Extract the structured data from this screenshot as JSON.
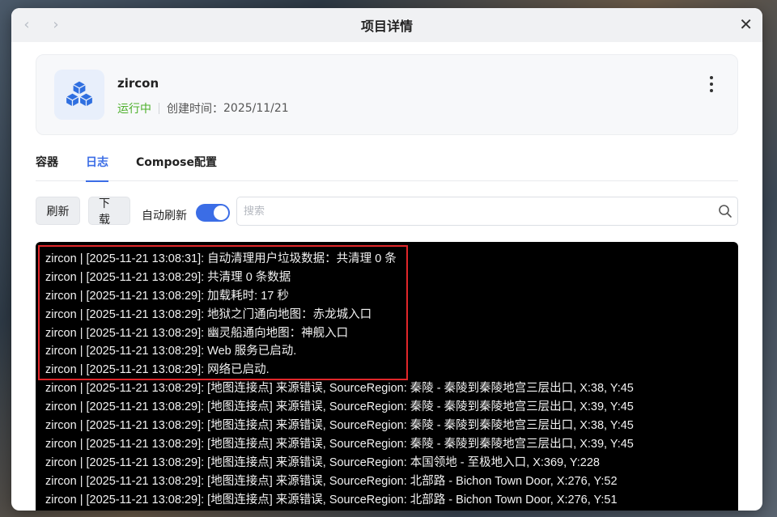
{
  "window": {
    "title": "项目详情",
    "back_icon": "‹",
    "forward_icon": "›",
    "close_icon": "✕"
  },
  "project": {
    "name": "zircon",
    "status": "运行中",
    "status_color": "#4caf2a",
    "created_label": "创建时间：",
    "created_value": "2025/11/21",
    "icon": "cubes-icon"
  },
  "tabs": [
    {
      "label": "容器",
      "active": false
    },
    {
      "label": "日志",
      "active": true
    },
    {
      "label": "Compose配置",
      "active": false
    }
  ],
  "toolbar": {
    "refresh_label": "刷新",
    "download_label": "下载",
    "auto_refresh_label": "自动刷新",
    "auto_refresh_on": true,
    "search_placeholder": "搜索",
    "search_value": ""
  },
  "accent_color": "#3b6de6",
  "logs": [
    "zircon  | [2025-11-21 13:08:31]: 自动清理用户垃圾数据：共清理 0 条",
    "zircon  | [2025-11-21 13:08:29]: 共清理 0 条数据",
    "zircon  | [2025-11-21 13:08:29]: 加载耗时: 17 秒",
    "zircon  | [2025-11-21 13:08:29]: 地狱之门通向地图：赤龙城入口",
    "zircon  | [2025-11-21 13:08:29]: 幽灵船通向地图：神舰入口",
    "zircon  | [2025-11-21 13:08:29]: Web 服务已启动.",
    "zircon  | [2025-11-21 13:08:29]: 网络已启动.",
    "zircon  | [2025-11-21 13:08:29]: [地图连接点] 来源错误, SourceRegion: 秦陵 - 秦陵到秦陵地宫三层出口, X:38, Y:45",
    "zircon  | [2025-11-21 13:08:29]: [地图连接点] 来源错误, SourceRegion: 秦陵 - 秦陵到秦陵地宫三层出口, X:39, Y:45",
    "zircon  | [2025-11-21 13:08:29]: [地图连接点] 来源错误, SourceRegion: 秦陵 - 秦陵到秦陵地宫三层出口, X:38, Y:45",
    "zircon  | [2025-11-21 13:08:29]: [地图连接点] 来源错误, SourceRegion: 秦陵 - 秦陵到秦陵地宫三层出口, X:39, Y:45",
    "zircon  | [2025-11-21 13:08:29]: [地图连接点] 来源错误, SourceRegion: 本国领地 - 至极地入口, X:369, Y:228",
    "zircon  | [2025-11-21 13:08:29]: [地图连接点] 来源错误, SourceRegion: 北部路 - Bichon Town Door, X:276, Y:52",
    "zircon  | [2025-11-21 13:08:29]: [地图连接点] 来源错误, SourceRegion: 北部路 - Bichon Town Door, X:276, Y:51"
  ],
  "highlighted_lines": 7
}
